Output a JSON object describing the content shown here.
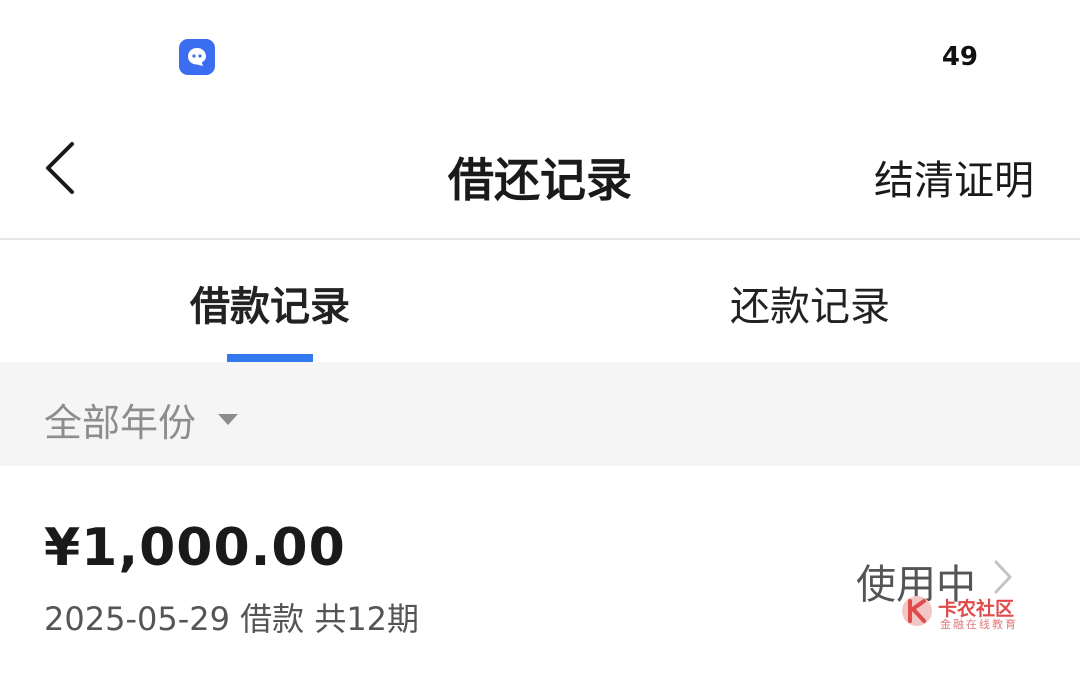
{
  "status_bar": {
    "app_icon": "chat-bubble-app-icon",
    "battery_level": "49"
  },
  "nav": {
    "title": "借还记录",
    "right_action": "结清证明",
    "back_icon": "chevron-left-icon"
  },
  "tabs": [
    {
      "label": "借款记录",
      "active": true
    },
    {
      "label": "还款记录",
      "active": false
    }
  ],
  "colors": {
    "accent": "#3478f0",
    "filter_bg": "#f5f5f5"
  },
  "filter": {
    "year_label": "全部年份",
    "caret_icon": "caret-down-icon"
  },
  "records": [
    {
      "amount": "¥1,000.00",
      "meta": "2025-05-29 借款 共12期",
      "status": "使用中",
      "chevron_icon": "chevron-right-icon"
    }
  ],
  "watermark": {
    "name": "卡农社区",
    "sub": "金融在线教育"
  }
}
